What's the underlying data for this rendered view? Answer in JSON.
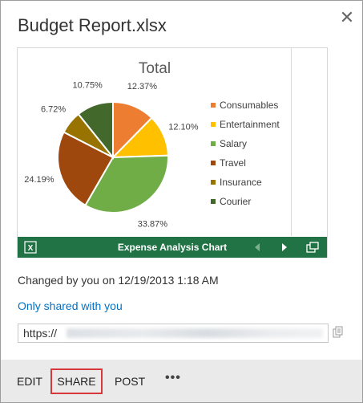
{
  "window": {
    "title": "Budget Report.xlsx",
    "close_icon": "close-icon"
  },
  "colors": {
    "excel_green": "#217346",
    "link_blue": "#0072c6",
    "highlight_red": "#d6383b",
    "footer_bg": "#eaeaea"
  },
  "preview": {
    "bar_title": "Expense Analysis Chart",
    "icons": [
      "excel-icon",
      "prev-arrow-icon",
      "next-arrow-icon",
      "popout-icon"
    ]
  },
  "chart_data": {
    "type": "pie",
    "title": "Total",
    "categories": [
      "Consumables",
      "Entertainment",
      "Salary",
      "Travel",
      "Insurance",
      "Courier"
    ],
    "values": [
      12.37,
      12.1,
      33.87,
      24.19,
      6.72,
      10.75
    ],
    "labels": [
      "12.37%",
      "12.10%",
      "33.87%",
      "24.19%",
      "6.72%",
      "10.75%"
    ],
    "colors": [
      "#ed7d31",
      "#ffc000",
      "#70ad47",
      "#9e480e",
      "#997300",
      "#43682b"
    ],
    "legend_position": "right"
  },
  "info": {
    "changed": "Changed by you on 12/19/2013 1:18 AM",
    "shared": "Only shared with you",
    "url_prefix": "https://"
  },
  "actions": {
    "edit": "EDIT",
    "share": "SHARE",
    "post": "POST",
    "more": "•••"
  }
}
